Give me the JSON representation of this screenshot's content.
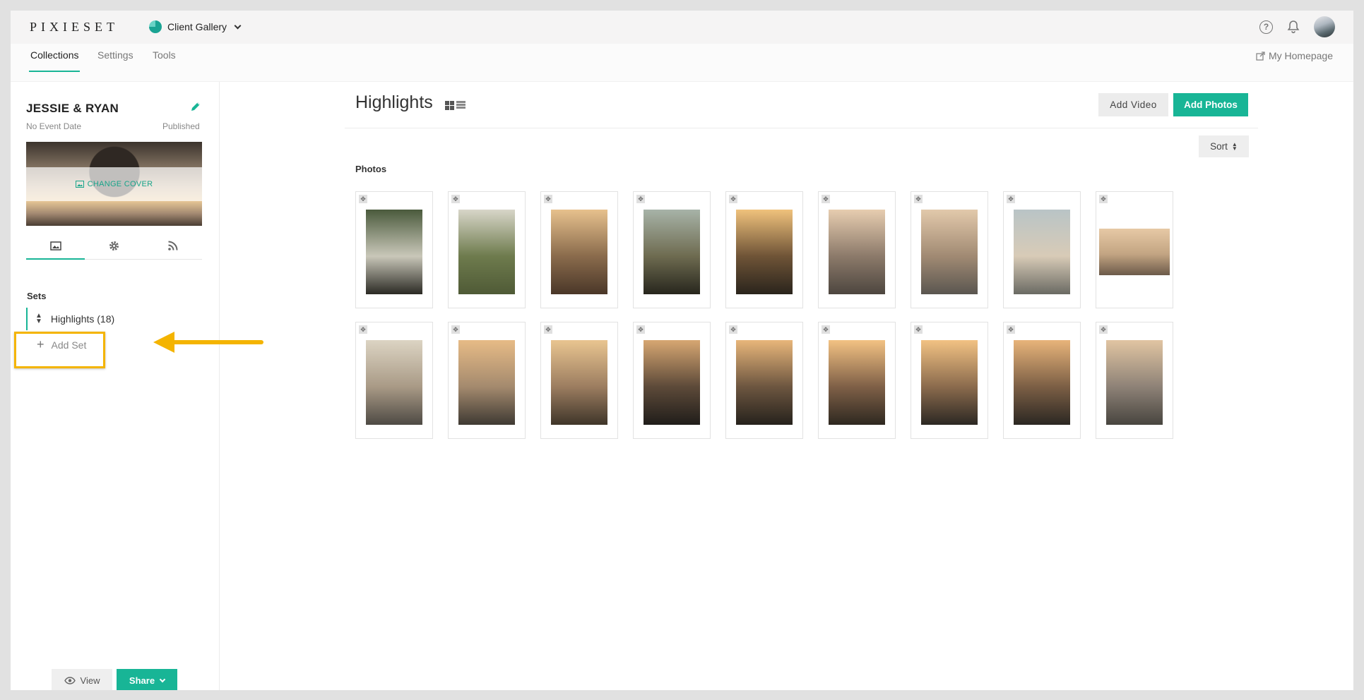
{
  "brand": {
    "logo": "PIXIESET"
  },
  "gallery_switch": {
    "label": "Client Gallery"
  },
  "nav": {
    "tabs": [
      "Collections",
      "Settings",
      "Tools"
    ],
    "homepage_link": "My Homepage"
  },
  "collection": {
    "title": "JESSIE & RYAN",
    "event_date": "No Event Date",
    "status": "Published",
    "change_cover": "CHANGE COVER",
    "sets_label": "Sets",
    "sets": [
      {
        "label": "Highlights (18)"
      }
    ],
    "add_set_label": "Add Set"
  },
  "sidebar_footer": {
    "view_label": "View",
    "share_label": "Share"
  },
  "main": {
    "title": "Highlights",
    "add_video": "Add Video",
    "add_photos": "Add Photos",
    "sort_label": "Sort",
    "photos_label": "Photos"
  },
  "photos": [
    {
      "orientation": "portrait",
      "palette": [
        "#4a5a3c",
        "#c9c7b9",
        "#2b2a24"
      ]
    },
    {
      "orientation": "portrait",
      "palette": [
        "#d8d6c9",
        "#6e7b4d",
        "#4f5a36"
      ]
    },
    {
      "orientation": "portrait",
      "palette": [
        "#e7c18d",
        "#8a6b4c",
        "#4a3728"
      ]
    },
    {
      "orientation": "portrait",
      "palette": [
        "#a7b3a8",
        "#6e6b50",
        "#27261d"
      ]
    },
    {
      "orientation": "portrait",
      "palette": [
        "#f0c27c",
        "#6f5437",
        "#2a241c"
      ]
    },
    {
      "orientation": "portrait",
      "palette": [
        "#e7cdb0",
        "#8c7a6a",
        "#4d463f"
      ]
    },
    {
      "orientation": "portrait",
      "palette": [
        "#e2c9ab",
        "#a18a73",
        "#5a5650"
      ]
    },
    {
      "orientation": "portrait",
      "palette": [
        "#b9c4c6",
        "#d8cbb7",
        "#6a6a63"
      ]
    },
    {
      "orientation": "landscape",
      "palette": [
        "#e7c9a5",
        "#c2a482",
        "#6c5a4a"
      ]
    },
    {
      "orientation": "portrait",
      "palette": [
        "#dcd4c3",
        "#a99a86",
        "#4e4a44"
      ]
    },
    {
      "orientation": "portrait",
      "palette": [
        "#e7bb86",
        "#a48a6e",
        "#3f3a33"
      ]
    },
    {
      "orientation": "portrait",
      "palette": [
        "#e9c590",
        "#9c7d60",
        "#3f3529"
      ]
    },
    {
      "orientation": "portrait",
      "palette": [
        "#d7a772",
        "#5d4a39",
        "#201d1a"
      ]
    },
    {
      "orientation": "portrait",
      "palette": [
        "#e8b67a",
        "#6d5640",
        "#26221c"
      ]
    },
    {
      "orientation": "portrait",
      "palette": [
        "#f3c283",
        "#7f6047",
        "#2e2820"
      ]
    },
    {
      "orientation": "portrait",
      "palette": [
        "#f2c283",
        "#8b6b4d",
        "#2c2823"
      ]
    },
    {
      "orientation": "portrait",
      "palette": [
        "#e8b47a",
        "#7c5f45",
        "#2b2722"
      ]
    },
    {
      "orientation": "portrait",
      "palette": [
        "#e1c5a2",
        "#8e8277",
        "#48453f"
      ]
    }
  ],
  "colors": {
    "accent": "#18b596",
    "highlight": "#f4b400"
  }
}
